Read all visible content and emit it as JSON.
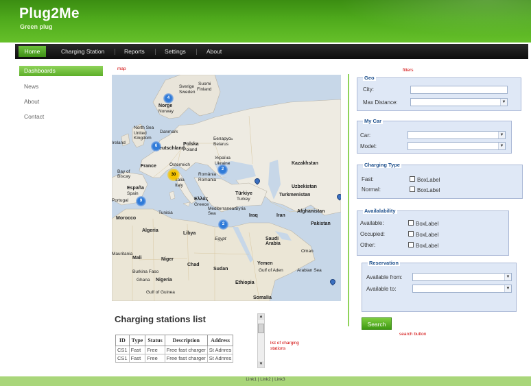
{
  "brand": {
    "title": "Plug2Me",
    "subtitle": "Green plug"
  },
  "nav": {
    "items": [
      "Home",
      "Charging Station",
      "Reports",
      "Settings",
      "About"
    ]
  },
  "sidebar": {
    "items": [
      "Dashboards",
      "News",
      "About",
      "Contact"
    ]
  },
  "notes": {
    "map": "map",
    "filters": "filters",
    "list": "list of charging stations",
    "search": "search button"
  },
  "map": {
    "countries": [
      "Sverige",
      "Suomi",
      "Finland",
      "Norge",
      "Norway",
      "Sweden",
      "North Sea",
      "United Kingdom",
      "Ireland",
      "Danmark",
      "Deutschland",
      "Polska",
      "Poland",
      "Беларусь",
      "Belarus",
      "Україна",
      "Ukraine",
      "Österreich",
      "Bay of Biscay",
      "France",
      "România",
      "Romania",
      "Kazakhstan",
      "Italia",
      "Italy",
      "España",
      "Spain",
      "Portugal",
      "Ελλάς",
      "Greece",
      "Türkiye",
      "Turkey",
      "Uzbekistan",
      "Turkmenistan",
      "Mediterranean Sea",
      "Syria",
      "Iraq",
      "Iran",
      "Afghanistan",
      "Pakistan",
      "Morocco",
      "Tunisia",
      "Algeria",
      "Libya",
      "Egypt",
      "Saudi Arabia",
      "Oman",
      "Mauritania",
      "Mali",
      "Niger",
      "Chad",
      "Sudan",
      "Yemen",
      "Gulf of Aden",
      "Arabian Sea",
      "Burkina Faso",
      "Ghana",
      "Nigeria",
      "Ethiopia",
      "Gulf of Guinea",
      "Somalia"
    ],
    "clusters": [
      "4",
      "6",
      "30",
      "2",
      "9",
      "2"
    ]
  },
  "list": {
    "title": "Charging stations list",
    "columns": [
      "ID",
      "Type",
      "Status",
      "Description",
      "Address"
    ],
    "rows": [
      [
        "CS1",
        "Fast",
        "Free",
        "Free fast charger",
        "St Adnres"
      ],
      [
        "CS1",
        "Fast",
        "Free",
        "Free fast charger",
        "St Adnres"
      ]
    ]
  },
  "filters": {
    "geo": {
      "title": "Geo",
      "city": "City:",
      "max_distance": "Max Distance:"
    },
    "my_car": {
      "title": "My Car",
      "car": "Car:",
      "model": "Model:"
    },
    "charging_type": {
      "title": "Charging Type",
      "fast": "Fast:",
      "normal": "Normal:",
      "box": "BoxLabel"
    },
    "availability": {
      "title": "Availalability",
      "available": "Available:",
      "occupied": "Occupied:",
      "other": "Other:",
      "box": "BoxLabel"
    },
    "reservation": {
      "title": "Reservation",
      "from": "Available from:",
      "to": "Available to:"
    },
    "search": "Search"
  },
  "footer": {
    "links": "Link1 | Link2 | Link3"
  },
  "colors": {
    "brand_green": "#4faa1c",
    "nav_bg": "#111111",
    "panel_bg": "#dfe8f6",
    "note_red": "#d00000",
    "cluster_blue": "#2f7bd9",
    "cluster_yellow": "#f5c400"
  },
  "icons": [
    "dropdown-arrow-icon",
    "scroll-up-icon",
    "scroll-down-icon",
    "map-pin-icon"
  ]
}
